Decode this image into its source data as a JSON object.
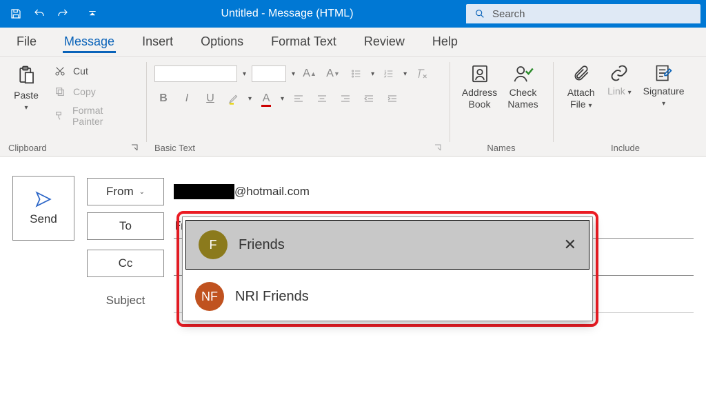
{
  "titlebar": {
    "title": "Untitled  -  Message (HTML)",
    "search_placeholder": "Search"
  },
  "tabs": {
    "file": "File",
    "message": "Message",
    "insert": "Insert",
    "options": "Options",
    "format_text": "Format Text",
    "review": "Review",
    "help": "Help",
    "active": "message"
  },
  "ribbon": {
    "clipboard": {
      "label": "Clipboard",
      "paste": "Paste",
      "cut": "Cut",
      "copy": "Copy",
      "format_painter": "Format Painter"
    },
    "basic_text": {
      "label": "Basic Text"
    },
    "names": {
      "label": "Names",
      "address_book": "Address Book",
      "check_names": "Check Names"
    },
    "include": {
      "label": "Include",
      "attach_file": "Attach File",
      "link": "Link",
      "signature": "Signature"
    }
  },
  "compose": {
    "send": "Send",
    "from_label": "From",
    "from_email_suffix": "@hotmail.com",
    "to_label": "To",
    "to_value": "Friends",
    "cc_label": "Cc",
    "subject_label": "Subject"
  },
  "suggestions": [
    {
      "initials": "F",
      "name": "Friends",
      "avatar_class": "av-f",
      "selected": true
    },
    {
      "initials": "NF",
      "name": "NRI Friends",
      "avatar_class": "av-nf",
      "selected": false
    }
  ]
}
